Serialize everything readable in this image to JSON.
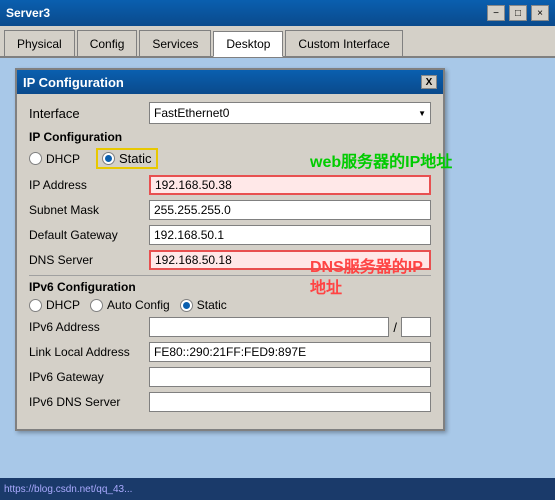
{
  "window": {
    "title": "Server3",
    "close_btn": "×",
    "minimize_btn": "−",
    "maximize_btn": "□"
  },
  "tabs": [
    {
      "id": "physical",
      "label": "Physical",
      "active": false
    },
    {
      "id": "config",
      "label": "Config",
      "active": false
    },
    {
      "id": "services",
      "label": "Services",
      "active": false
    },
    {
      "id": "desktop",
      "label": "Desktop",
      "active": true
    },
    {
      "id": "custom",
      "label": "Custom Interface",
      "active": false
    }
  ],
  "dialog": {
    "title": "IP Configuration",
    "close_btn": "X",
    "interface_label": "Interface",
    "interface_value": "FastEthernet0",
    "ip_config_section": "IP Configuration",
    "dhcp_label": "DHCP",
    "static_label": "Static",
    "ip_address_label": "IP Address",
    "ip_address_value": "192.168.50.38",
    "subnet_mask_label": "Subnet Mask",
    "subnet_mask_value": "255.255.255.0",
    "default_gateway_label": "Default Gateway",
    "default_gateway_value": "192.168.50.1",
    "dns_server_label": "DNS Server",
    "dns_server_value": "192.168.50.18",
    "ipv6_section": "IPv6 Configuration",
    "ipv6_dhcp_label": "DHCP",
    "ipv6_auto_label": "Auto Config",
    "ipv6_static_label": "Static",
    "ipv6_address_label": "IPv6 Address",
    "ipv6_address_value": "",
    "ipv6_prefix": "",
    "link_local_label": "Link Local Address",
    "link_local_value": "FE80::290:21FF:FED9:897E",
    "ipv6_gateway_label": "IPv6 Gateway",
    "ipv6_gateway_value": "",
    "ipv6_dns_label": "IPv6 DNS Server",
    "ipv6_dns_value": ""
  },
  "annotations": {
    "web": "web服务器的IP地址",
    "dns": "DNS服务器的IP地址"
  },
  "bottom_bar": {
    "text": "https://blog.csdn.net/qq_43..."
  }
}
